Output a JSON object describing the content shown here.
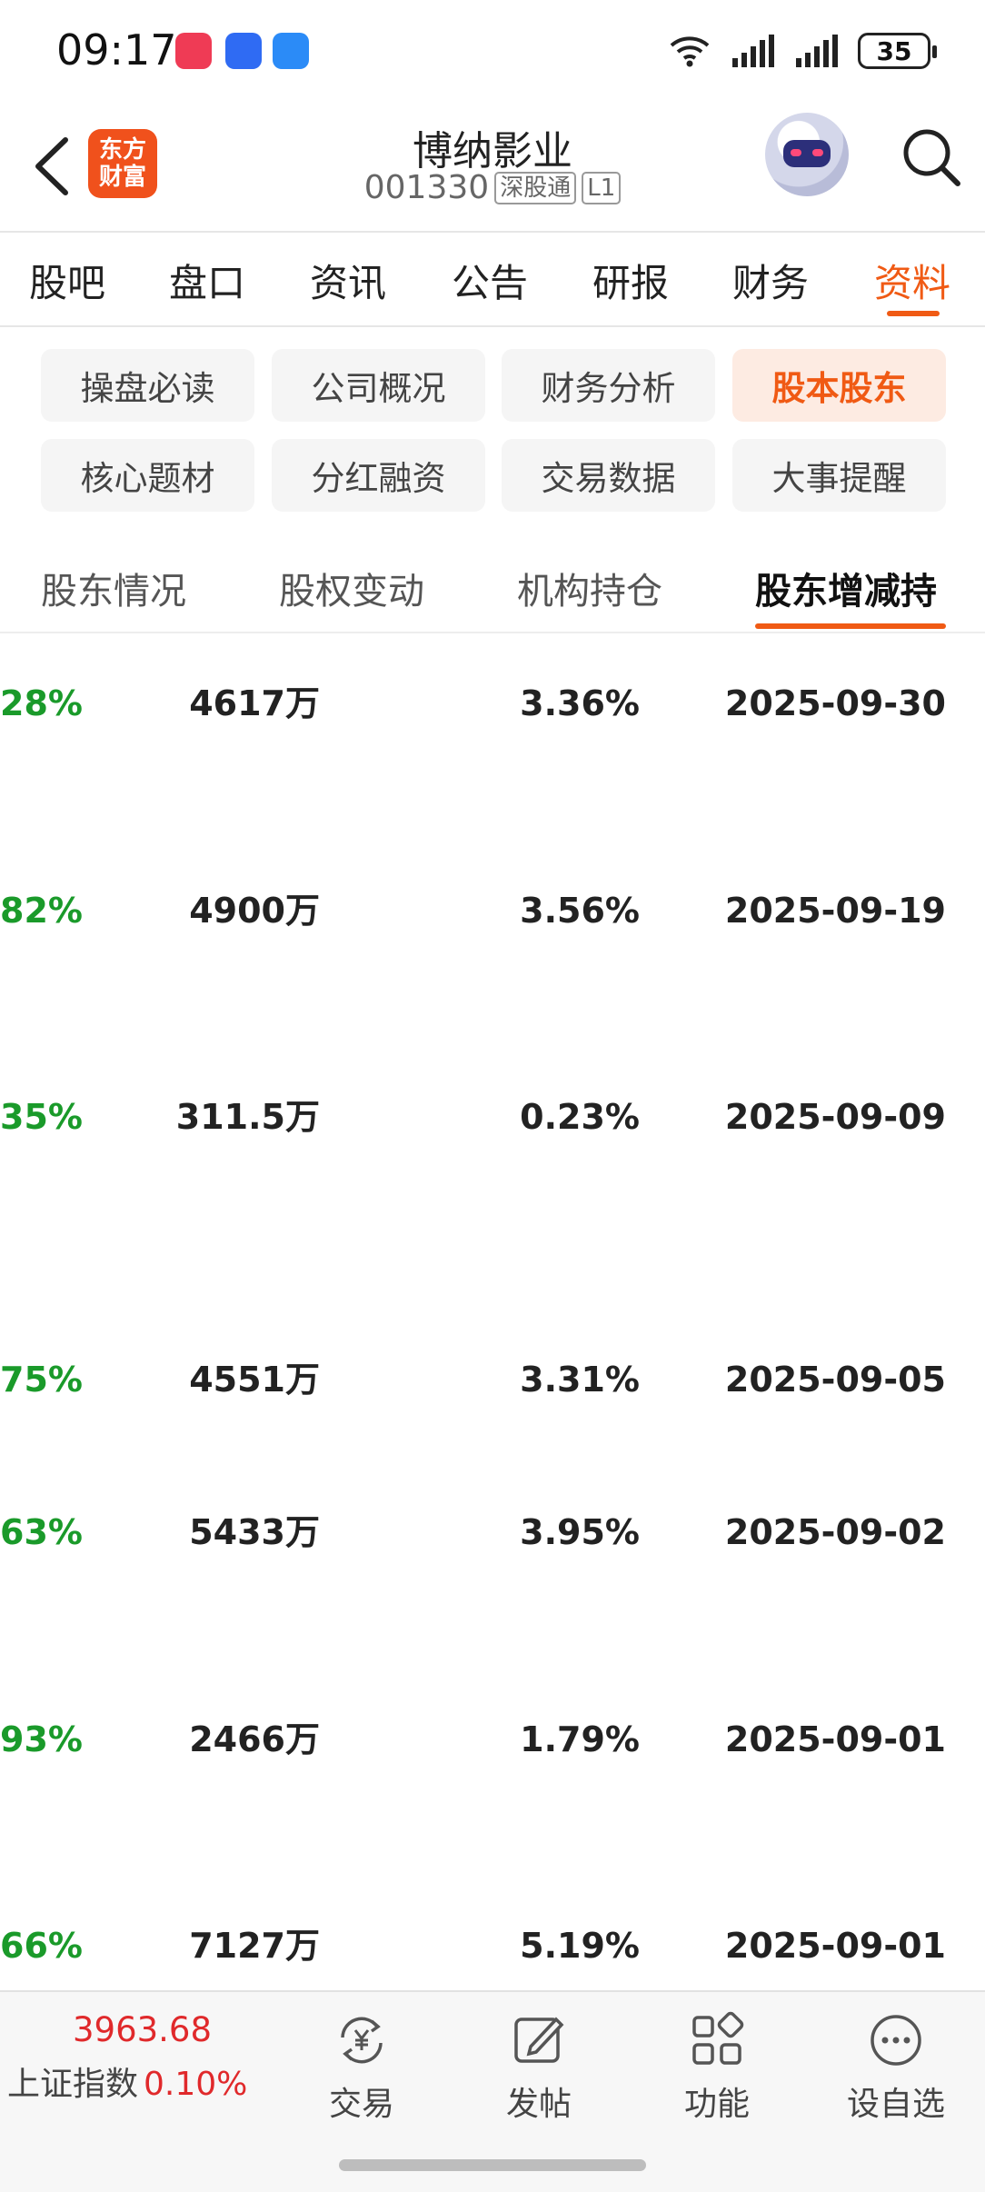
{
  "status_bar": {
    "time": "09:17",
    "battery": "35",
    "icons": [
      "app-gallery-icon",
      "contacts-app-icon",
      "messages-app-icon",
      "wifi-icon",
      "signal-icon",
      "signal-icon"
    ]
  },
  "header": {
    "back_icon": "chevron-left-icon",
    "app_logo": "东方\n财富",
    "stock_name": "博纳影业",
    "stock_code": "001330",
    "tag_market": "深股通",
    "tag_level": "L1",
    "search_icon": "search-icon"
  },
  "main_tabs": [
    {
      "label": "股吧",
      "active": false
    },
    {
      "label": "盘口",
      "active": false
    },
    {
      "label": "资讯",
      "active": false
    },
    {
      "label": "公告",
      "active": false
    },
    {
      "label": "研报",
      "active": false
    },
    {
      "label": "财务",
      "active": false
    },
    {
      "label": "资料",
      "active": true
    }
  ],
  "sub_tabs": [
    {
      "label": "操盘必读",
      "active": false
    },
    {
      "label": "公司概况",
      "active": false
    },
    {
      "label": "财务分析",
      "active": false
    },
    {
      "label": "股本股东",
      "active": true
    },
    {
      "label": "核心题材",
      "active": false
    },
    {
      "label": "分红融资",
      "active": false
    },
    {
      "label": "交易数据",
      "active": false
    },
    {
      "label": "大事提醒",
      "active": false
    }
  ],
  "third_tabs": [
    {
      "label": "股东情况",
      "active": false
    },
    {
      "label": "股权变动",
      "active": false
    },
    {
      "label": "机构持仓",
      "active": false
    },
    {
      "label": "股东增减持",
      "active": true
    }
  ],
  "table_rows": [
    {
      "pct_change": "28%",
      "shares": "4617万",
      "ratio": "3.36%",
      "date": "2025-09-30"
    },
    {
      "pct_change": "82%",
      "shares": "4900万",
      "ratio": "3.56%",
      "date": "2025-09-19"
    },
    {
      "pct_change": "35%",
      "shares": "311.5万",
      "ratio": "0.23%",
      "date": "2025-09-09"
    },
    {
      "pct_change": "75%",
      "shares": "4551万",
      "ratio": "3.31%",
      "date": "2025-09-05"
    },
    {
      "pct_change": "63%",
      "shares": "5433万",
      "ratio": "3.95%",
      "date": "2025-09-02"
    },
    {
      "pct_change": "93%",
      "shares": "2466万",
      "ratio": "1.79%",
      "date": "2025-09-01"
    },
    {
      "pct_change": "66%",
      "shares": "7127万",
      "ratio": "5.19%",
      "date": "2025-09-01"
    }
  ],
  "bottom_bar": {
    "index_value": "3963.68",
    "index_name": "上证指数",
    "index_change": "0.10%",
    "items": [
      {
        "label": "交易",
        "icon": "yuan-exchange-icon"
      },
      {
        "label": "发帖",
        "icon": "compose-icon"
      },
      {
        "label": "功能",
        "icon": "grid-apps-icon"
      },
      {
        "label": "设自选",
        "icon": "more-dots-icon"
      }
    ]
  },
  "colors": {
    "accent": "#f05a14",
    "up_red": "#e0292b",
    "down_green": "#1a9a2a"
  }
}
